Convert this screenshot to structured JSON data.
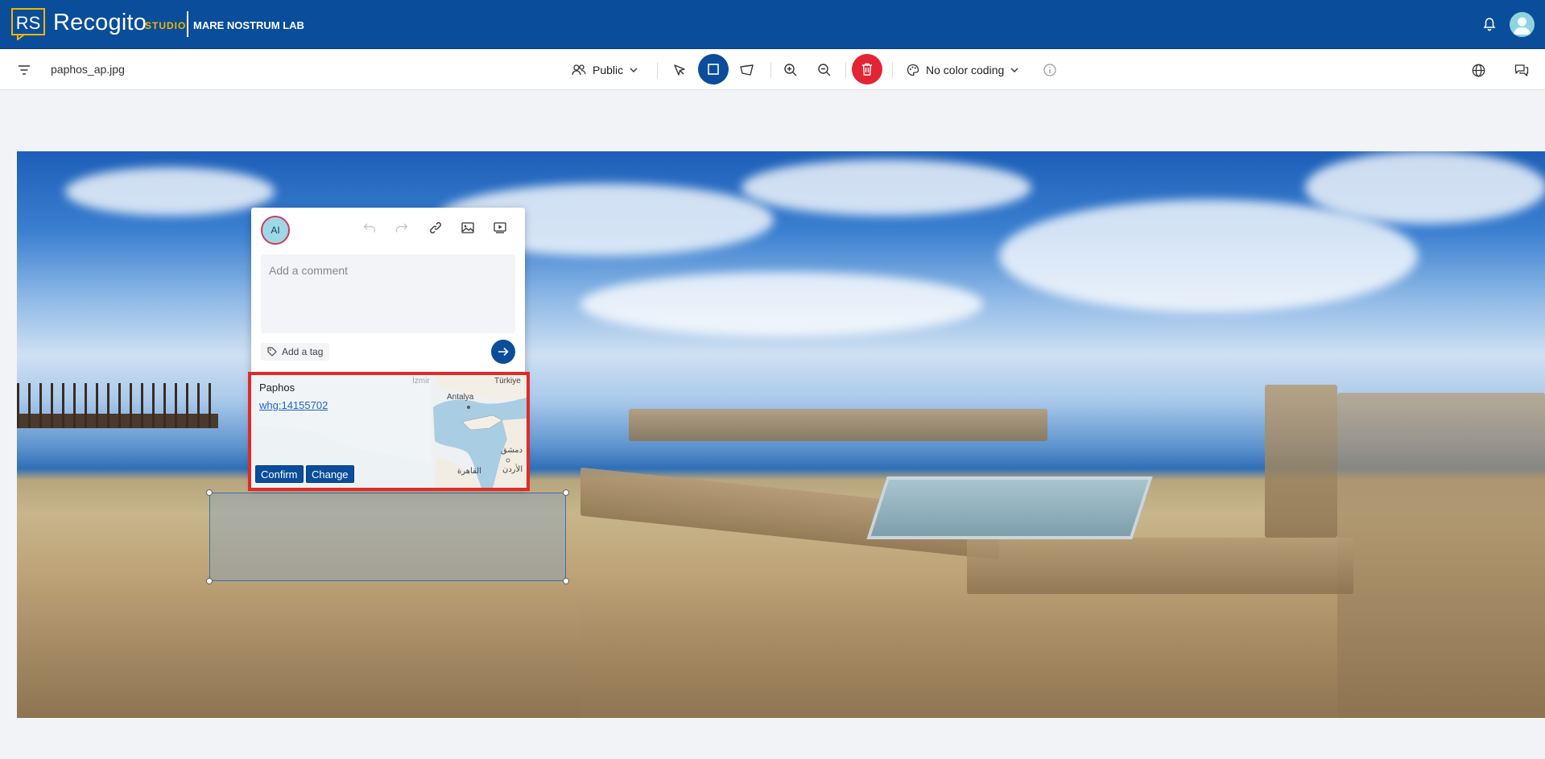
{
  "header": {
    "brand_name": "Recogito",
    "brand_product": "STUDIO",
    "organization": "MARE NOSTRUM LAB",
    "logo_initials": "RS"
  },
  "toolbar": {
    "filename": "paphos_ap.jpg",
    "visibility_label": "Public",
    "color_coding_label": "No color coding"
  },
  "popup": {
    "avatar_initials": "AI",
    "comment_placeholder": "Add a comment",
    "tag_label": "Add a tag"
  },
  "geotag": {
    "place_name": "Paphos",
    "gazetteer_id": "whg:14155702",
    "confirm_label": "Confirm",
    "change_label": "Change",
    "map_labels": {
      "turkiye": "Türkiye",
      "antalya": "Antalya",
      "izmir": "İzmir",
      "damascus": "دمشق",
      "cairo": "القاهرة",
      "jordan": "الأردن"
    }
  },
  "colors": {
    "header_bg": "#0a4d9a",
    "active_tool": "#0a4d9a",
    "delete_tool": "#e32434",
    "highlight_border": "#e02a2a",
    "brand_accent": "#f2b400"
  }
}
